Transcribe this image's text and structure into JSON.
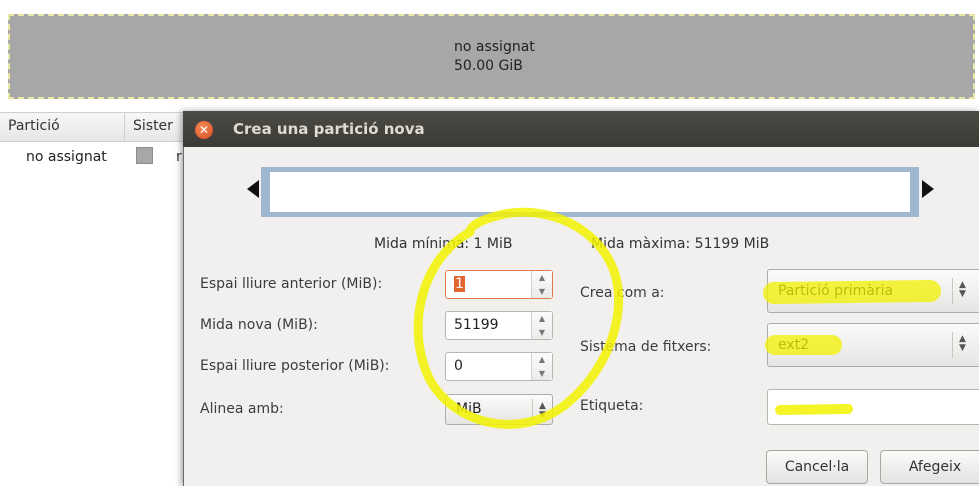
{
  "graph": {
    "block_name": "no assignat",
    "block_size": "50.00 GiB"
  },
  "table": {
    "columns": [
      "Partició",
      "Sister"
    ],
    "rows": [
      {
        "partition": "no assignat",
        "extra": "r"
      }
    ]
  },
  "dialog": {
    "title": "Crea una partició nova",
    "min_size": "Mida mínima: 1 MiB",
    "max_size": "Mida màxima: 51199 MiB",
    "fields": {
      "free_before_label": "Espai lliure anterior (MiB):",
      "free_before_value": "1",
      "new_size_label": "Mida nova (MiB):",
      "new_size_value": "51199",
      "free_after_label": "Espai lliure posterior (MiB):",
      "free_after_value": "0",
      "align_label": "Alinea amb:",
      "align_value": "MiB",
      "create_as_label": "Crea com a:",
      "create_as_value": "Partició primària",
      "filesystem_label": "Sistema de fitxers:",
      "filesystem_value": "ext2",
      "label_label": "Etiqueta:",
      "label_value": ""
    },
    "buttons": {
      "cancel": "Cancel·la",
      "add": "Afegeix"
    }
  },
  "colors": {
    "title_bar": "#3f3e39",
    "close_button": "#e2592a",
    "unallocated": "#a7a7a7",
    "highlight": "#f4f400"
  },
  "icons": {
    "close": "close-icon",
    "spin_up": "arrow-up-icon",
    "spin_down": "arrow-down-icon",
    "combo": "updown-chevron-icon",
    "resize_left": "triangle-left-icon",
    "resize_right": "triangle-right-icon"
  }
}
